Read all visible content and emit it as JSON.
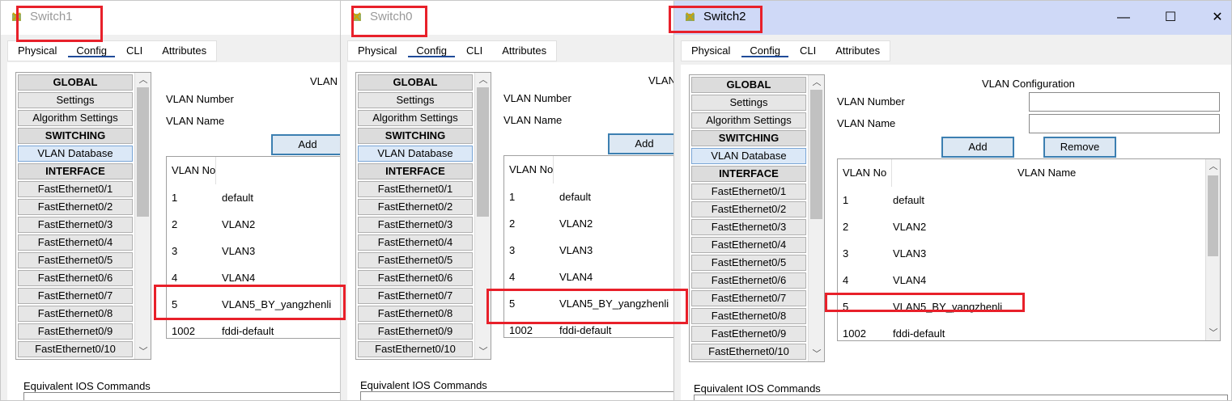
{
  "tabs": [
    "Physical",
    "Config",
    "CLI",
    "Attributes"
  ],
  "nav": [
    {
      "label": "GLOBAL",
      "hdr": true
    },
    {
      "label": "Settings"
    },
    {
      "label": "Algorithm Settings"
    },
    {
      "label": "SWITCHING",
      "hdr": true
    },
    {
      "label": "VLAN Database",
      "sel": true
    },
    {
      "label": "INTERFACE",
      "hdr": true
    },
    {
      "label": "FastEthernet0/1"
    },
    {
      "label": "FastEthernet0/2"
    },
    {
      "label": "FastEthernet0/3"
    },
    {
      "label": "FastEthernet0/4"
    },
    {
      "label": "FastEthernet0/5"
    },
    {
      "label": "FastEthernet0/6"
    },
    {
      "label": "FastEthernet0/7"
    },
    {
      "label": "FastEthernet0/8"
    },
    {
      "label": "FastEthernet0/9"
    },
    {
      "label": "FastEthernet0/10"
    }
  ],
  "vlan_config": {
    "title": "VLAN Configuration",
    "title_clipped": "VLAN C",
    "number_label": "VLAN Number",
    "name_label": "VLAN Name",
    "add_label": "Add",
    "remove_label": "Remove",
    "col_no": "VLAN No",
    "col_name": "VLAN Name"
  },
  "vlans": [
    {
      "no": "1",
      "name": "default"
    },
    {
      "no": "2",
      "name": "VLAN2"
    },
    {
      "no": "3",
      "name": "VLAN3"
    },
    {
      "no": "4",
      "name": "VLAN4"
    },
    {
      "no": "5",
      "name": "VLAN5_BY_yangzhenli"
    },
    {
      "no": "1002",
      "name": "fddi-default"
    }
  ],
  "equivalent_label": "Equivalent IOS Commands",
  "windows": {
    "switch1": {
      "title": "Switch1"
    },
    "switch0": {
      "title": "Switch0"
    },
    "switch2": {
      "title": "Switch2",
      "minimize": "—",
      "maximize": "☐",
      "close": "✕"
    }
  },
  "colors": {
    "highlight": "#e8202a",
    "active_title": "#cfd9f7",
    "button_border": "#3c7fb1"
  }
}
